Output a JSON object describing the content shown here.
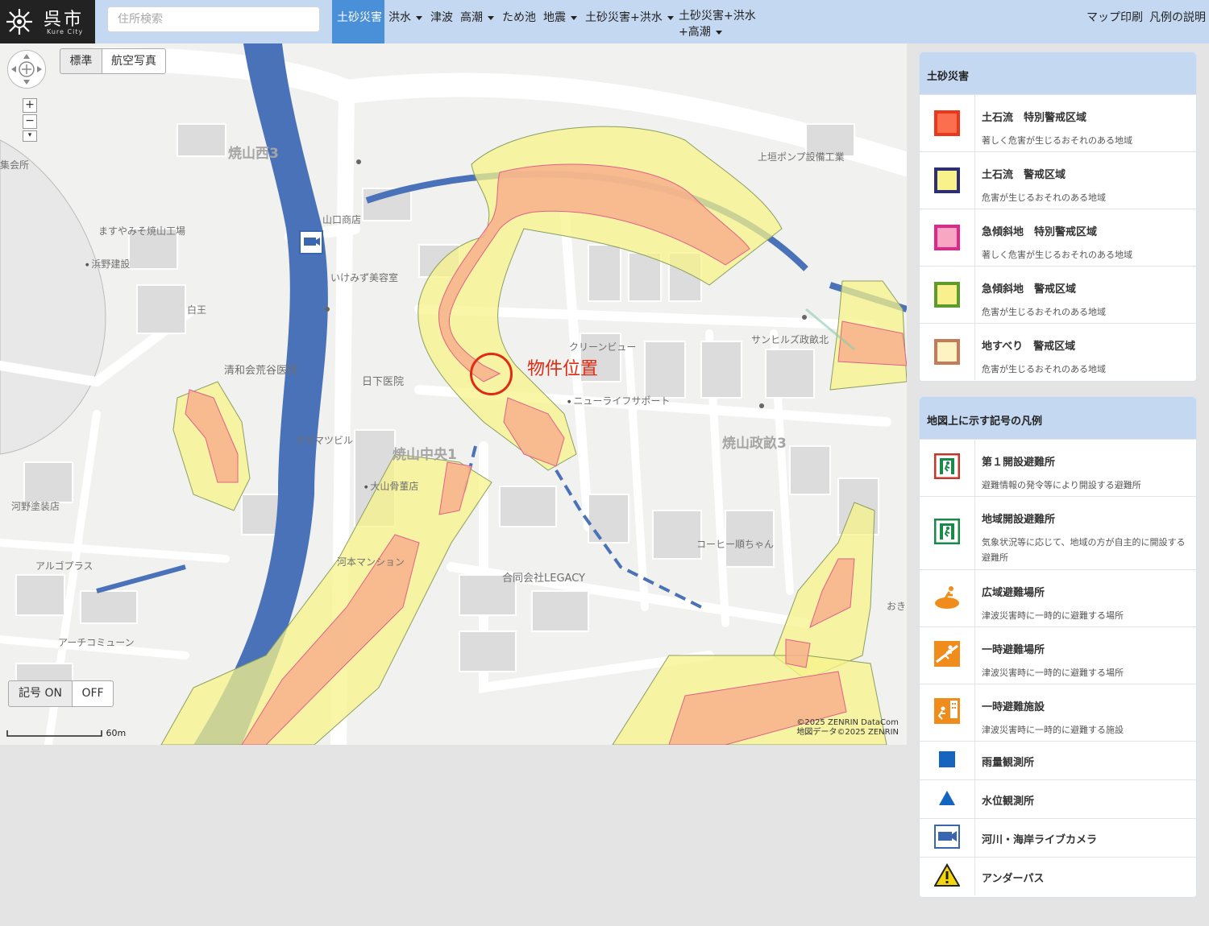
{
  "header": {
    "logo_kanji": "呉市",
    "logo_roman": "Kure City",
    "search_placeholder": "住所検索",
    "nav": [
      {
        "label": "土砂災害",
        "active": true
      },
      {
        "label": "洪水",
        "dropdown": true
      },
      {
        "label": "津波"
      },
      {
        "label": "高潮",
        "dropdown": true
      },
      {
        "label": "ため池"
      },
      {
        "label": "地震",
        "dropdown": true
      },
      {
        "label": "土砂災害+洪水",
        "dropdown": true
      },
      {
        "label_line1": "土砂災害+洪水",
        "label_line2": "+高潮",
        "dropdown": true
      }
    ],
    "right_links": [
      "マップ印刷",
      "凡例の説明"
    ]
  },
  "map": {
    "basemap_buttons": [
      "標準",
      "航空写真"
    ],
    "zoom_in": "+",
    "zoom_out": "−",
    "symbol_toggle": {
      "on": "記号 ON",
      "off": "OFF"
    },
    "property_label": "物件位置",
    "scale_label": "60m",
    "attribution_line1": "©2025 ZENRIN DataCom",
    "attribution_line2": "地図データ©2025 ZENRIN",
    "district_labels": [
      "焼山西3",
      "焼山中央1",
      "焼山政畝3"
    ],
    "poi_labels": [
      "ますやみそ焼山工場",
      "浜野建設",
      "白王",
      "清和会荒谷医院",
      "日下医院",
      "タカマツビル",
      "大山骨董店",
      "河野塗装店",
      "アルゴプラス",
      "アーチコミューン",
      "河本マンション",
      "合同会社LEGACY",
      "コーヒー順ちゃん",
      "ニューライフサポート",
      "クリーンビュー",
      "サンヒルズ政畝北",
      "上垣ポンプ設備工業",
      "山口商店",
      "いけみず美容室",
      "集会所",
      "おき"
    ]
  },
  "legend_hazard": {
    "title": "土砂災害",
    "items": [
      {
        "title": "土石流　特別警戒区域",
        "desc": "著しく危害が生じるおそれのある地域",
        "fill": "#fb6f4f",
        "border": "#e8391c"
      },
      {
        "title": "土石流　警戒区域",
        "desc": "危害が生じるおそれのある地域",
        "fill": "#f9f18a",
        "border": "#2c2f72"
      },
      {
        "title": "急傾斜地　特別警戒区域",
        "desc": "著しく危害が生じるおそれのある地域",
        "fill": "#f8a7c3",
        "border": "#e0288a"
      },
      {
        "title": "急傾斜地　警戒区域",
        "desc": "危害が生じるおそれのある地域",
        "fill": "#f7f08c",
        "border": "#5e9a2c"
      },
      {
        "title": "地すべり　警戒区域",
        "desc": "危害が生じるおそれのある地域",
        "fill": "#fdf2c2",
        "border": "#c57a5a"
      }
    ]
  },
  "legend_symbols": {
    "title": "地図上に示す記号の凡例",
    "items": [
      {
        "title": "第１開設避難所",
        "desc": "避難情報の発令等により開設する避難所",
        "icon": "evacuation-shelter-red-icon"
      },
      {
        "title": "地域開設避難所",
        "desc": "気象状況等に応じて、地域の方が自主的に開設する避難所",
        "icon": "evacuation-shelter-green-icon"
      },
      {
        "title": "広域避難場所",
        "desc": "津波災害時に一時的に避難する場所",
        "icon": "wide-area-evacuation-icon"
      },
      {
        "title": "一時避難場所",
        "desc": "津波災害時に一時的に避難する場所",
        "icon": "temporary-evacuation-site-icon"
      },
      {
        "title": "一時避難施設",
        "desc": "津波災害時に一時的に避難する施設",
        "icon": "temporary-evacuation-facility-icon"
      },
      {
        "title": "雨量観測所",
        "icon": "rain-gauge-icon"
      },
      {
        "title": "水位観測所",
        "icon": "water-level-station-icon"
      },
      {
        "title": "河川・海岸ライブカメラ",
        "icon": "live-camera-icon"
      },
      {
        "title": "アンダーパス",
        "icon": "underpass-warning-icon"
      }
    ]
  },
  "colors": {
    "header_bg": "#c5d8f1",
    "nav_active": "#4a90d9",
    "river": "#4a72b8",
    "warning_zone": "#f7f38a",
    "special_zone": "#f7b08c",
    "marker": "#e02a12"
  }
}
